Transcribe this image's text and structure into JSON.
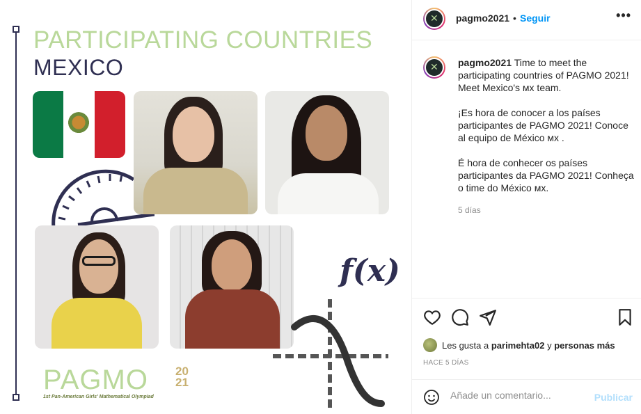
{
  "post": {
    "title_line1": "PARTICIPATING COUNTRIES",
    "title_line2": "MEXICO",
    "formula": "f(x)",
    "logo_word": "PAGMO",
    "logo_year_top": "20",
    "logo_year_bottom": "21",
    "logo_subtitle": "1st Pan-American Girls' Mathematical Olympiad"
  },
  "header": {
    "username": "pagmo2021",
    "separator": "•",
    "follow_label": "Seguir",
    "more_label": "•••"
  },
  "caption": {
    "username": "pagmo2021",
    "paragraph1": "Time to meet the participating countries of PAGMO 2021! Meet Mexico's ᴍx team.",
    "paragraph2": "¡Es hora de conocer a los países participantes de PAGMO 2021! Conoce al equipo de México ᴍx .",
    "paragraph3": "É hora de conhecer os países participantes da PAGMO 2021! Conheça o time do México ᴍx.",
    "time_ago": "5 días"
  },
  "likes": {
    "prefix": "Les gusta a",
    "user": "parimehta02",
    "connector": "y",
    "others": "personas más"
  },
  "posted": "HACE 5 DÍAS",
  "comment": {
    "placeholder": "Añade un comentario...",
    "publish_label": "Publicar"
  },
  "colors": {
    "accent_green": "#b9d89a",
    "navy": "#2f2f52",
    "link_blue": "#0095f6",
    "publish_disabled": "#b2dffc"
  },
  "icons": [
    "heart-icon",
    "comment-icon",
    "share-icon",
    "bookmark-icon",
    "emoji-icon",
    "more-icon"
  ]
}
